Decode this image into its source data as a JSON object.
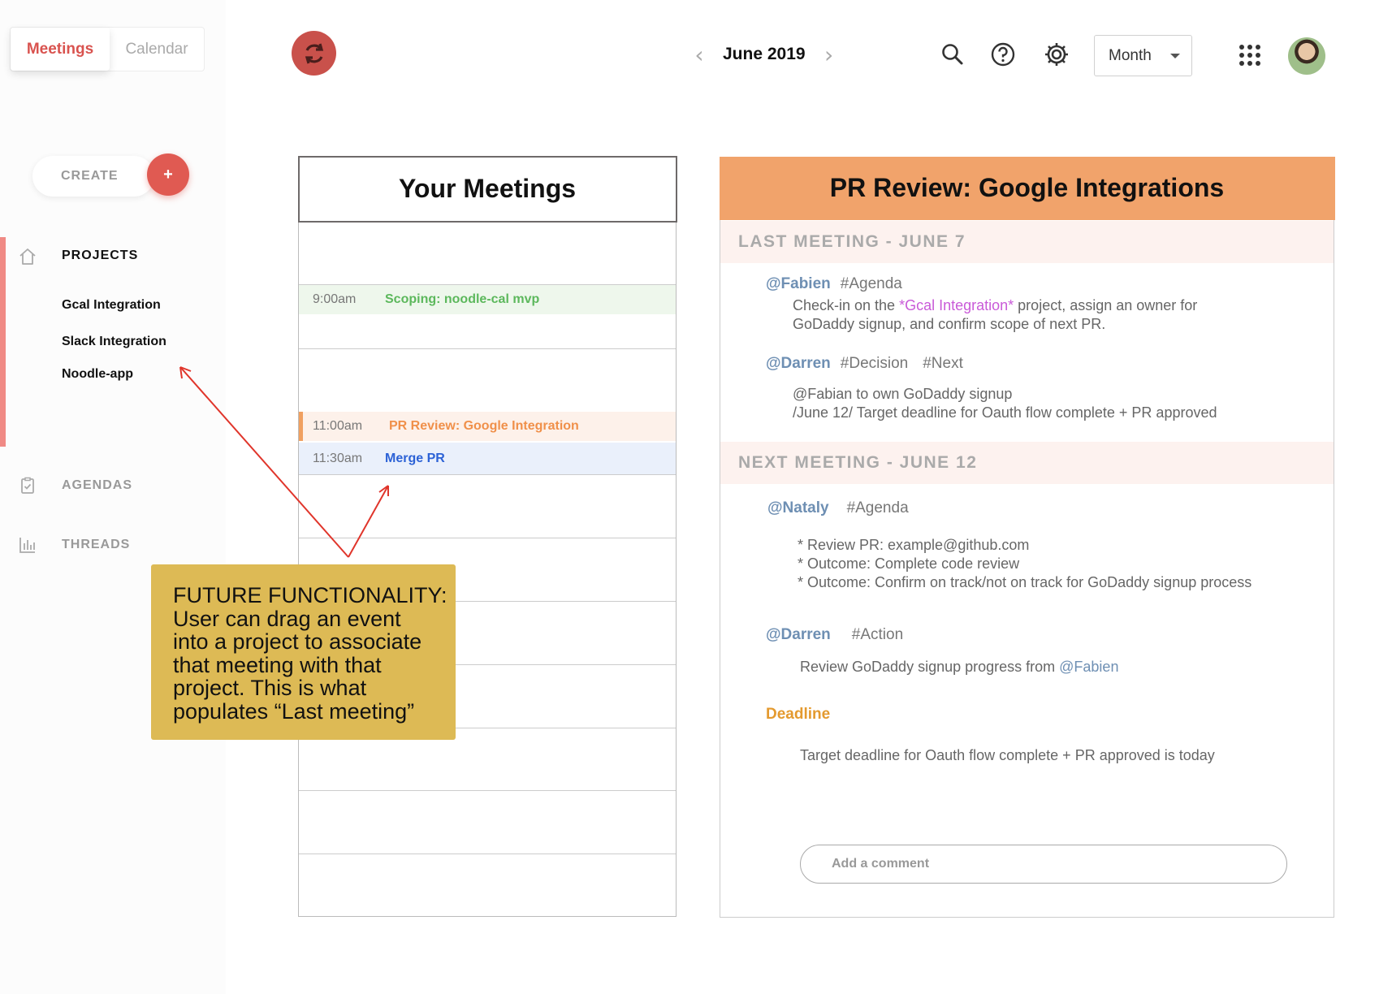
{
  "sidebar": {
    "view_tabs": {
      "meetings": "Meetings",
      "calendar": "Calendar"
    },
    "create_label": "CREATE",
    "create_button": "+",
    "nav": {
      "projects": "PROJECTS",
      "agendas": "AGENDAS",
      "threads": "THREADS"
    },
    "projects": [
      "Gcal Integration",
      "Slack Integration",
      "Noodle-app"
    ]
  },
  "header": {
    "month": "June 2019",
    "prev_arrow": "‹",
    "next_arrow": "›",
    "view_select": "Month",
    "icons": [
      "refresh-icon",
      "search-icon",
      "help-icon",
      "gear-icon",
      "apps-grid-icon",
      "avatar"
    ]
  },
  "meetings": {
    "title": "Your Meetings",
    "events": [
      {
        "time": "9:00am",
        "title": "Scoping: noodle-cal mvp",
        "color": "#5cb85c"
      },
      {
        "time": "11:00am",
        "title": "PR Review: Google Integration",
        "color": "#f0904a"
      },
      {
        "time": "11:30am",
        "title": "Merge PR",
        "color": "#2c62d6"
      }
    ]
  },
  "note": {
    "lines": [
      "FUTURE FUNCTIONALITY:",
      "User can drag an event",
      "into a project to associate",
      "that meeting with that",
      "project. This is what",
      "populates “Last meeting”"
    ]
  },
  "detail": {
    "title": "PR Review: Google Integrations",
    "last_meeting": {
      "heading": "LAST MEETING - JUNE 7",
      "entries": [
        {
          "author": "@Fabien",
          "tags": [
            "#Agenda"
          ],
          "text_before": "Check-in on the ",
          "link": "*Gcal Integration*",
          "text_after": " project, assign an owner for",
          "line2": "GoDaddy signup, and confirm scope of next PR."
        },
        {
          "author": "@Darren",
          "tags": [
            "#Decision",
            "#Next"
          ],
          "line1": "@Fabian to own GoDaddy signup",
          "line2": "/June 12/ Target deadline for Oauth flow complete + PR approved"
        }
      ]
    },
    "next_meeting": {
      "heading": "NEXT MEETING - JUNE 12",
      "entries": [
        {
          "author": "@Nataly",
          "tags": [
            "#Agenda"
          ],
          "lines": [
            "* Review PR: example@github.com",
            "* Outcome: Complete code review",
            "* Outcome: Confirm on track/not on track for GoDaddy signup process"
          ]
        },
        {
          "author": "@Darren",
          "tags": [
            "#Action"
          ],
          "text_before": "Review GoDaddy signup progress from ",
          "link": "@Fabien"
        }
      ],
      "deadline_label": "Deadline",
      "deadline_text": "Target deadline for Oauth flow complete + PR approved is today"
    },
    "comment_placeholder": "Add a comment"
  },
  "colors": {
    "accent_red": "#e05a52",
    "header_orange": "#f1a36b",
    "note_yellow": "#ddba55",
    "mention_blue": "#6e8fb3"
  }
}
